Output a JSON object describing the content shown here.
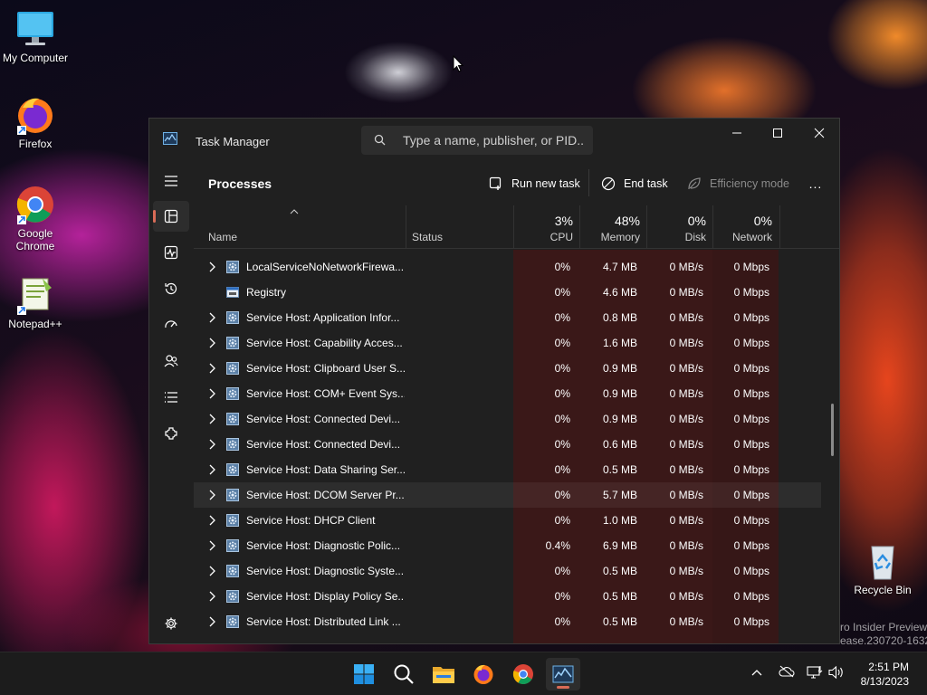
{
  "desktop": {
    "icons": [
      {
        "label": "My Computer",
        "icon": "monitor-icon"
      },
      {
        "label": "Firefox",
        "icon": "firefox-icon"
      },
      {
        "label": "Google Chrome",
        "icon": "chrome-icon"
      },
      {
        "label": "Notepad++",
        "icon": "notepadpp-icon"
      },
      {
        "label": "Recycle Bin",
        "icon": "recycle-bin-icon"
      }
    ],
    "watermark_line1": "ro Insider Preview",
    "watermark_line2": "ease.230720-1632"
  },
  "window": {
    "title": "Task Manager",
    "search_placeholder": "Type a name, publisher, or PID...",
    "controls": [
      "minimize",
      "maximize",
      "close"
    ]
  },
  "nav": {
    "items": [
      {
        "name": "hamburger-menu-icon"
      },
      {
        "name": "processes-icon",
        "active": true
      },
      {
        "name": "performance-icon"
      },
      {
        "name": "app-history-icon"
      },
      {
        "name": "startup-apps-icon"
      },
      {
        "name": "users-icon"
      },
      {
        "name": "details-icon"
      },
      {
        "name": "services-icon"
      },
      {
        "name": "settings-icon"
      }
    ]
  },
  "toolbar": {
    "page_title": "Processes",
    "run_new_task": "Run new task",
    "end_task": "End task",
    "efficiency_mode": "Efficiency mode",
    "more": "..."
  },
  "columns": {
    "name": "Name",
    "status": "Status",
    "cpu": {
      "label": "CPU",
      "pct": "3%"
    },
    "memory": {
      "label": "Memory",
      "pct": "48%"
    },
    "disk": {
      "label": "Disk",
      "pct": "0%"
    },
    "network": {
      "label": "Network",
      "pct": "0%"
    }
  },
  "processes": [
    {
      "name": "LocalServiceNoNetworkFirewa...",
      "cpu": "0%",
      "memory": "4.7 MB",
      "disk": "0 MB/s",
      "network": "0 Mbps",
      "expandable": true,
      "icon": "service-gear-icon"
    },
    {
      "name": "Registry",
      "cpu": "0%",
      "memory": "4.6 MB",
      "disk": "0 MB/s",
      "network": "0 Mbps",
      "expandable": false,
      "icon": "registry-window-icon"
    },
    {
      "name": "Service Host: Application Infor...",
      "cpu": "0%",
      "memory": "0.8 MB",
      "disk": "0 MB/s",
      "network": "0 Mbps",
      "expandable": true,
      "icon": "service-gear-icon"
    },
    {
      "name": "Service Host: Capability Acces...",
      "cpu": "0%",
      "memory": "1.6 MB",
      "disk": "0 MB/s",
      "network": "0 Mbps",
      "expandable": true,
      "icon": "service-gear-icon"
    },
    {
      "name": "Service Host: Clipboard User S...",
      "cpu": "0%",
      "memory": "0.9 MB",
      "disk": "0 MB/s",
      "network": "0 Mbps",
      "expandable": true,
      "icon": "service-gear-icon"
    },
    {
      "name": "Service Host: COM+ Event Sys...",
      "cpu": "0%",
      "memory": "0.9 MB",
      "disk": "0 MB/s",
      "network": "0 Mbps",
      "expandable": true,
      "icon": "service-gear-icon"
    },
    {
      "name": "Service Host: Connected Devi...",
      "cpu": "0%",
      "memory": "0.9 MB",
      "disk": "0 MB/s",
      "network": "0 Mbps",
      "expandable": true,
      "icon": "service-gear-icon"
    },
    {
      "name": "Service Host: Connected Devi...",
      "cpu": "0%",
      "memory": "0.6 MB",
      "disk": "0 MB/s",
      "network": "0 Mbps",
      "expandable": true,
      "icon": "service-gear-icon"
    },
    {
      "name": "Service Host: Data Sharing Ser...",
      "cpu": "0%",
      "memory": "0.5 MB",
      "disk": "0 MB/s",
      "network": "0 Mbps",
      "expandable": true,
      "icon": "service-gear-icon"
    },
    {
      "name": "Service Host: DCOM Server Pr...",
      "cpu": "0%",
      "memory": "5.7 MB",
      "disk": "0 MB/s",
      "network": "0 Mbps",
      "expandable": true,
      "icon": "service-gear-icon",
      "highlighted": true
    },
    {
      "name": "Service Host: DHCP Client",
      "cpu": "0%",
      "memory": "1.0 MB",
      "disk": "0 MB/s",
      "network": "0 Mbps",
      "expandable": true,
      "icon": "service-gear-icon"
    },
    {
      "name": "Service Host: Diagnostic Polic...",
      "cpu": "0.4%",
      "memory": "6.9 MB",
      "disk": "0 MB/s",
      "network": "0 Mbps",
      "expandable": true,
      "icon": "service-gear-icon"
    },
    {
      "name": "Service Host: Diagnostic Syste...",
      "cpu": "0%",
      "memory": "0.5 MB",
      "disk": "0 MB/s",
      "network": "0 Mbps",
      "expandable": true,
      "icon": "service-gear-icon"
    },
    {
      "name": "Service Host: Display Policy Se...",
      "cpu": "0%",
      "memory": "0.5 MB",
      "disk": "0 MB/s",
      "network": "0 Mbps",
      "expandable": true,
      "icon": "service-gear-icon"
    },
    {
      "name": "Service Host: Distributed Link ...",
      "cpu": "0%",
      "memory": "0.5 MB",
      "disk": "0 MB/s",
      "network": "0 Mbps",
      "expandable": true,
      "icon": "service-gear-icon"
    }
  ],
  "taskbar": {
    "apps": [
      "start-icon",
      "search-icon",
      "file-explorer-icon",
      "firefox-icon",
      "chrome-icon",
      "task-manager-icon"
    ],
    "active_app": "task-manager-icon",
    "clock_time": "2:51 PM",
    "clock_date": "8/13/2023"
  },
  "colors": {
    "accent": "#d96b57",
    "heat_column": "#3a1818",
    "window_bg": "#202020"
  }
}
